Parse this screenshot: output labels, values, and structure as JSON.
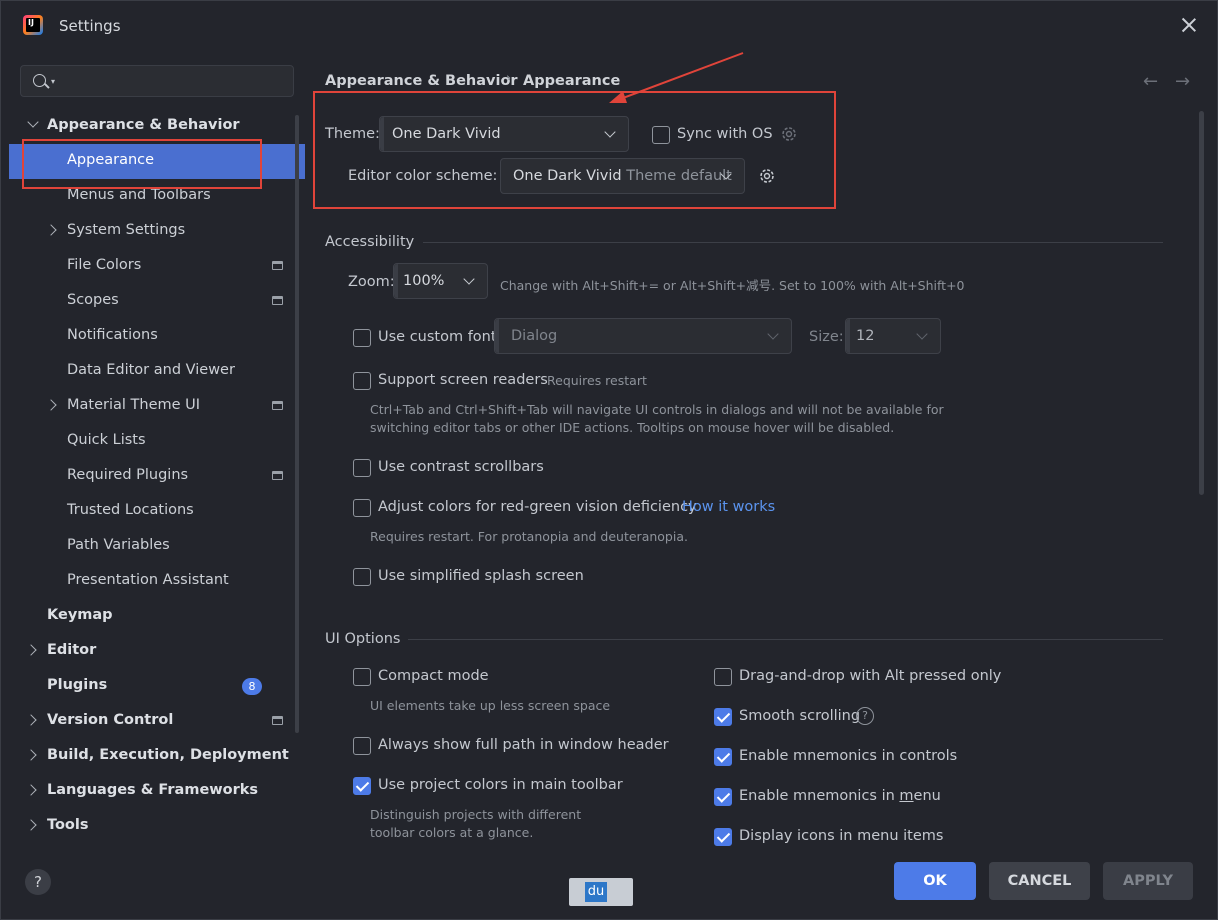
{
  "window": {
    "title": "Settings"
  },
  "search": {
    "placeholder": ""
  },
  "sidebar": {
    "items": [
      {
        "label": "Appearance & Behavior"
      },
      {
        "label": "Appearance"
      },
      {
        "label": "Menus and Toolbars"
      },
      {
        "label": "System Settings"
      },
      {
        "label": "File Colors"
      },
      {
        "label": "Scopes"
      },
      {
        "label": "Notifications"
      },
      {
        "label": "Data Editor and Viewer"
      },
      {
        "label": "Material Theme UI"
      },
      {
        "label": "Quick Lists"
      },
      {
        "label": "Required Plugins"
      },
      {
        "label": "Trusted Locations"
      },
      {
        "label": "Path Variables"
      },
      {
        "label": "Presentation Assistant"
      },
      {
        "label": "Keymap"
      },
      {
        "label": "Editor"
      },
      {
        "label": "Plugins",
        "badge": "8"
      },
      {
        "label": "Version Control"
      },
      {
        "label": "Build, Execution, Deployment"
      },
      {
        "label": "Languages & Frameworks"
      },
      {
        "label": "Tools"
      }
    ]
  },
  "breadcrumb": {
    "parent": "Appearance & Behavior",
    "current": "Appearance"
  },
  "theme": {
    "label": "Theme:",
    "value": "One Dark Vivid",
    "sync_label": "Sync with OS",
    "sync_checked": false
  },
  "editor_scheme": {
    "label": "Editor color scheme:",
    "value": "One Dark Vivid",
    "value_suffix": "Theme default"
  },
  "accessibility": {
    "title": "Accessibility",
    "zoom_label": "Zoom:",
    "zoom_value": "100%",
    "zoom_hint": "Change with Alt+Shift+= or Alt+Shift+减号. Set to 100% with Alt+Shift+0",
    "custom_font_label": "Use custom font:",
    "custom_font_checked": false,
    "font_value": "Dialog",
    "size_label": "Size:",
    "size_value": "12",
    "screen_readers_label": "Support screen readers",
    "screen_readers_checked": false,
    "screen_readers_hint": "Requires restart",
    "screen_readers_desc_1": "Ctrl+Tab and Ctrl+Shift+Tab will navigate UI controls in dialogs and will not be available for",
    "screen_readers_desc_2": "switching editor tabs or other IDE actions. Tooltips on mouse hover will be disabled.",
    "contrast_scrollbars_label": "Use contrast scrollbars",
    "contrast_scrollbars_checked": false,
    "red_green_label": "Adjust colors for red-green vision deficiency",
    "red_green_checked": false,
    "red_green_link": "How it works",
    "red_green_hint": "Requires restart. For protanopia and deuteranopia.",
    "splash_label": "Use simplified splash screen",
    "splash_checked": false
  },
  "ui_options": {
    "title": "UI Options",
    "compact_label": "Compact mode",
    "compact_checked": false,
    "compact_hint": "UI elements take up less screen space",
    "full_path_label": "Always show full path in window header",
    "full_path_checked": false,
    "project_colors_label": "Use project colors in main toolbar",
    "project_colors_checked": true,
    "project_colors_hint_1": "Distinguish projects with different",
    "project_colors_hint_2": "toolbar colors at a glance.",
    "dnd_label": "Drag-and-drop with Alt pressed only",
    "dnd_checked": false,
    "smooth_label": "Smooth scrolling",
    "smooth_checked": true,
    "mnemonics_controls_label": "Enable mnemonics in controls",
    "mnemonics_controls_checked": true,
    "mnemonics_menu_prefix": "Enable mnemonics in ",
    "mnemonics_menu_underlined": "m",
    "mnemonics_menu_suffix": "enu",
    "mnemonics_menu_checked": true,
    "menu_icons_label": "Display icons in menu items",
    "menu_icons_checked": true
  },
  "buttons": {
    "ok": "OK",
    "cancel": "CANCEL",
    "apply": "APPLY"
  },
  "help": {
    "label": "?"
  },
  "ime": {
    "label": "du"
  },
  "colors": {
    "accent": "#4d7be8",
    "selection": "#4a6fd0",
    "annotation": "#e0443a",
    "link": "#5b94ef"
  }
}
